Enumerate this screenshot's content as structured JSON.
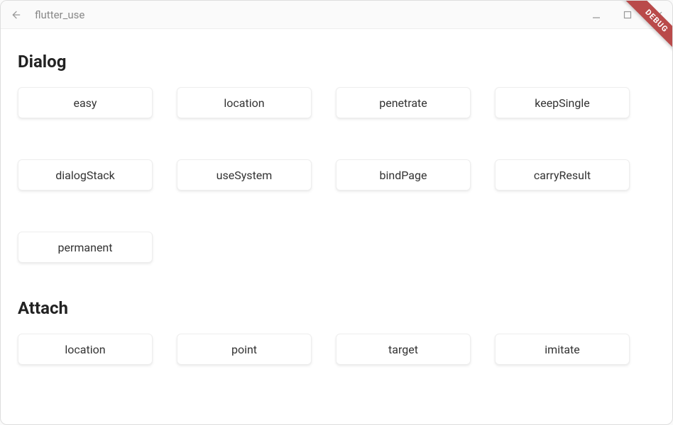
{
  "window": {
    "title": "flutter_use",
    "debug_label": "DEBUG"
  },
  "sections": {
    "dialog": {
      "title": "Dialog",
      "items": [
        "easy",
        "location",
        "penetrate",
        "keepSingle",
        "dialogStack",
        "useSystem",
        "bindPage",
        "carryResult",
        "permanent"
      ]
    },
    "attach": {
      "title": "Attach",
      "items": [
        "location",
        "point",
        "target",
        "imitate"
      ]
    }
  }
}
